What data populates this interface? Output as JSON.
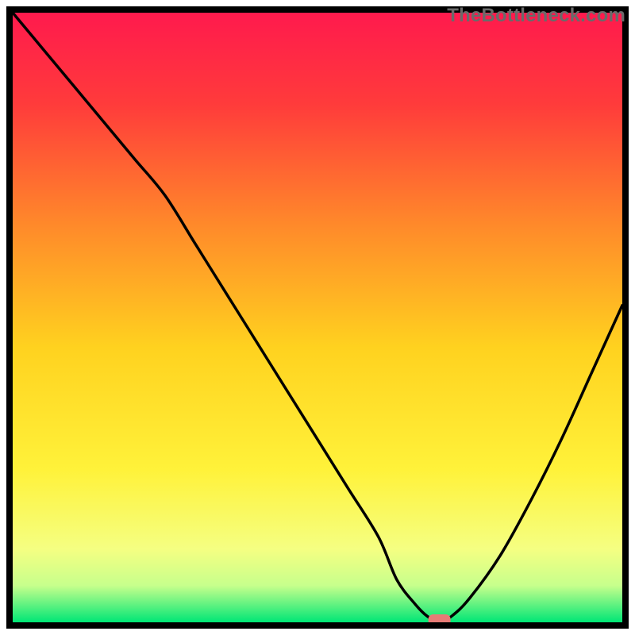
{
  "watermark": "TheBottleneck.com",
  "chart_data": {
    "type": "line",
    "title": "",
    "xlabel": "",
    "ylabel": "",
    "xlim": [
      0,
      100
    ],
    "ylim": [
      0,
      100
    ],
    "x": [
      0,
      5,
      10,
      15,
      20,
      25,
      30,
      35,
      40,
      45,
      50,
      55,
      60,
      63,
      66,
      68,
      70,
      72,
      75,
      80,
      85,
      90,
      95,
      100
    ],
    "values": [
      100,
      94,
      88,
      82,
      76,
      70,
      62,
      54,
      46,
      38,
      30,
      22,
      14,
      7,
      3,
      1,
      0,
      1,
      4,
      11,
      20,
      30,
      41,
      52
    ],
    "minimum_marker": {
      "x": 70,
      "value": 0,
      "color": "#e77b76"
    },
    "background_gradient_stops": [
      {
        "offset": 0.0,
        "color": "#ff1a4d"
      },
      {
        "offset": 0.15,
        "color": "#ff3b3b"
      },
      {
        "offset": 0.35,
        "color": "#ff8a2a"
      },
      {
        "offset": 0.55,
        "color": "#ffd21f"
      },
      {
        "offset": 0.75,
        "color": "#fff23a"
      },
      {
        "offset": 0.88,
        "color": "#f5ff82"
      },
      {
        "offset": 0.94,
        "color": "#c7ff8c"
      },
      {
        "offset": 1.0,
        "color": "#00e676"
      }
    ]
  }
}
